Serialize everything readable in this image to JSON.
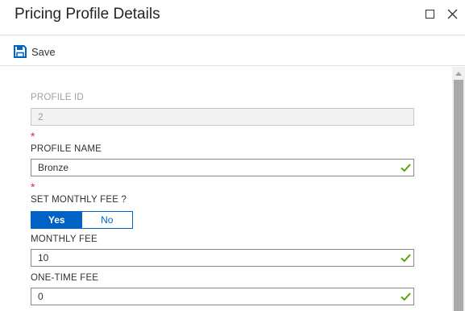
{
  "header": {
    "title": "Pricing Profile Details",
    "maximize_icon": "maximize-icon",
    "close_icon": "close-icon"
  },
  "toolbar": {
    "save_label": "Save",
    "save_icon": "save-icon"
  },
  "form": {
    "required_mark": "*",
    "profile_id": {
      "label": "PROFILE ID",
      "value": "2",
      "disabled": true
    },
    "profile_name": {
      "label": "PROFILE NAME",
      "value": "Bronze",
      "required": true,
      "valid": true
    },
    "set_monthly_fee": {
      "label": "SET MONTHLY FEE ?",
      "required": true,
      "options": [
        "Yes",
        "No"
      ],
      "selected": "Yes"
    },
    "monthly_fee": {
      "label": "MONTHLY FEE",
      "value": "10",
      "valid": true
    },
    "one_time_fee": {
      "label": "ONE-TIME FEE",
      "value": "0",
      "valid": true
    }
  },
  "colors": {
    "accent": "#0063c4",
    "valid_check": "#57a300",
    "required": "#d13438"
  }
}
